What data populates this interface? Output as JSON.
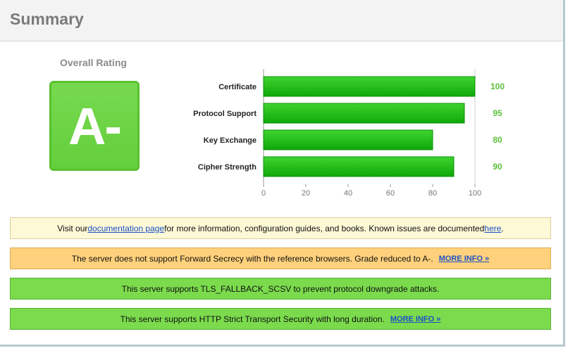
{
  "header": {
    "title": "Summary"
  },
  "rating": {
    "label": "Overall Rating",
    "grade": "A-"
  },
  "chart_data": {
    "type": "bar",
    "orientation": "horizontal",
    "categories": [
      "Certificate",
      "Protocol Support",
      "Key Exchange",
      "Cipher Strength"
    ],
    "values": [
      100,
      95,
      80,
      90
    ],
    "xlim": [
      0,
      100
    ],
    "xticks": [
      "0",
      "20",
      "40",
      "60",
      "80",
      "100"
    ],
    "bar_color": "#1eb80f",
    "label_color": "#5cbf3c",
    "grid": false
  },
  "notices": {
    "info": {
      "prefix": "Visit our ",
      "link1": "documentation page",
      "middle": " for more information, configuration guides, and books. Known issues are documented ",
      "link2": "here",
      "suffix": "."
    },
    "warn": {
      "text": "The server does not support Forward Secrecy with the reference browsers. Grade reduced to A-.",
      "more": "MORE INFO »"
    },
    "fallback": {
      "text": "This server supports TLS_FALLBACK_SCSV to prevent protocol downgrade attacks."
    },
    "hsts": {
      "text": "This server supports HTTP Strict Transport Security with long duration.",
      "more": "MORE INFO »"
    }
  },
  "colors": {
    "grade": "#64cf3c",
    "warn": "#ffd17c",
    "good": "#7bdb4d",
    "info": "#fdf8d6"
  }
}
